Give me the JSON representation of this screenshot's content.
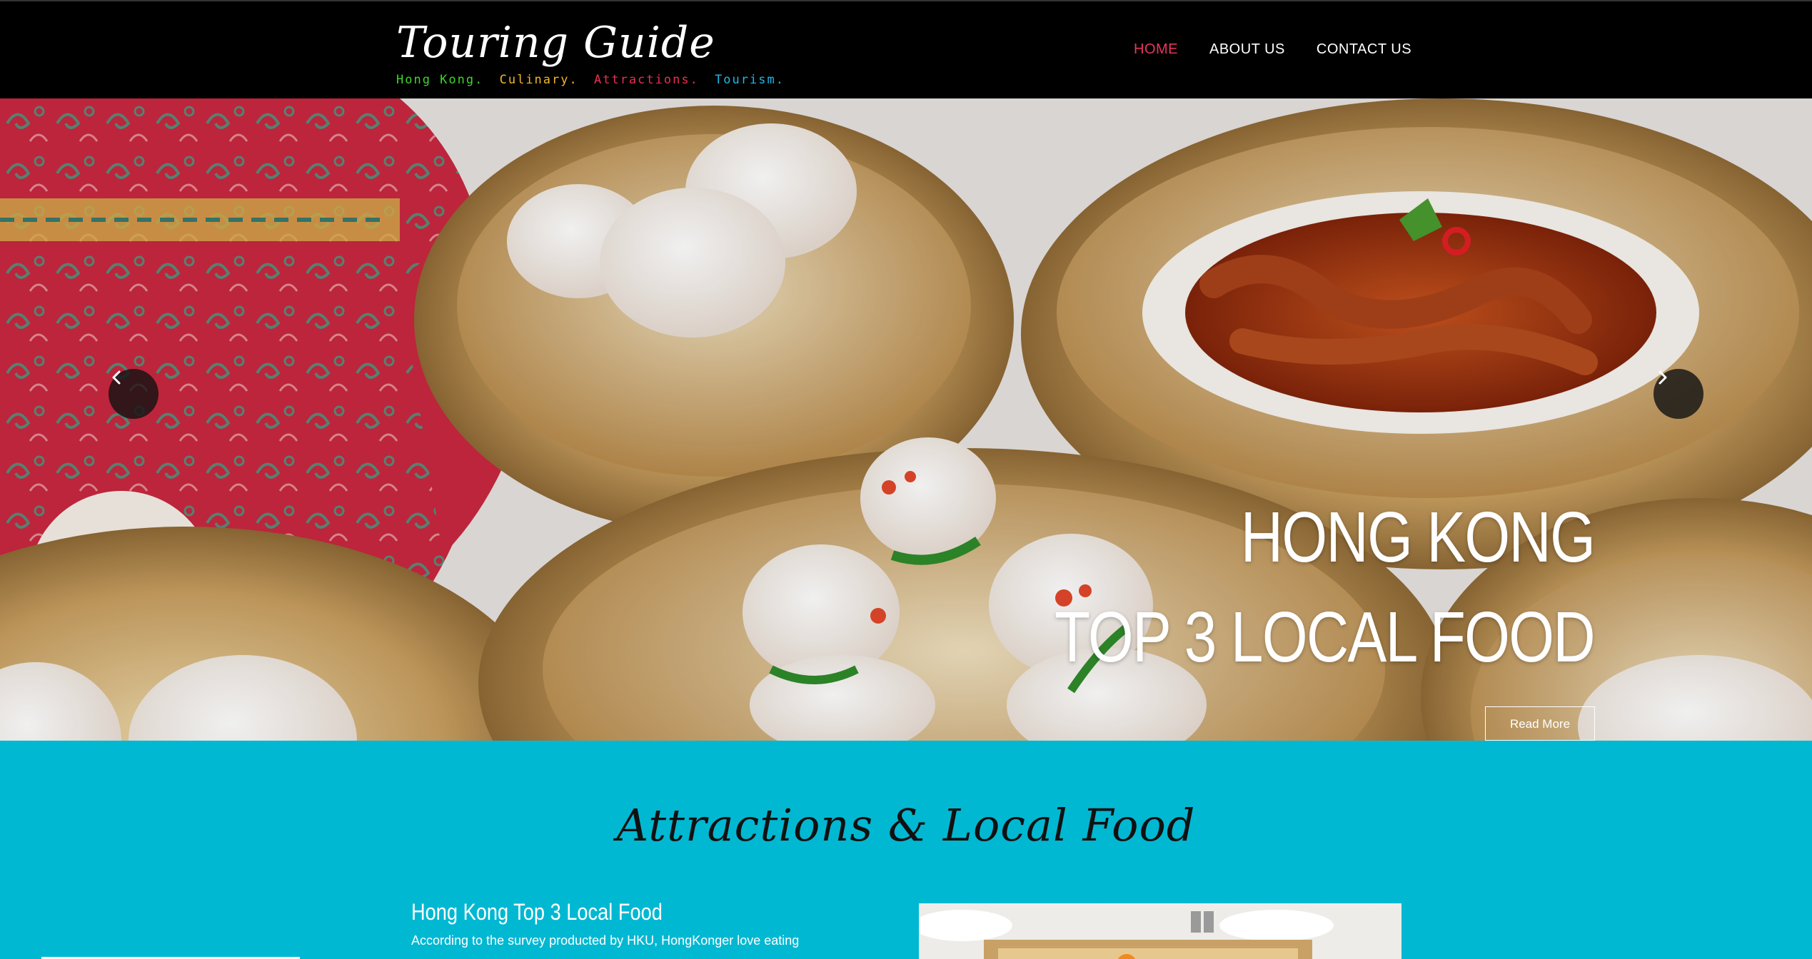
{
  "header": {
    "logo_title": "Touring Guide",
    "tagline": [
      {
        "text": "Hong Kong.",
        "color": "#3ed62b"
      },
      {
        "text": "Culinary.",
        "color": "#f1b52e"
      },
      {
        "text": "Attractions.",
        "color": "#e8304f"
      },
      {
        "text": "Tourism.",
        "color": "#20b8e6"
      }
    ],
    "nav": [
      {
        "label": "HOME",
        "active": true
      },
      {
        "label": "ABOUT US",
        "active": false
      },
      {
        "label": "CONTACT US",
        "active": false
      }
    ]
  },
  "hero": {
    "prev_icon": "chevron-left-icon",
    "next_icon": "chevron-right-icon",
    "caption_line1": "HONG KONG",
    "caption_line2": "TOP 3 LOCAL FOOD",
    "read_more": "Read More"
  },
  "section": {
    "title": "Attractions & Local Food",
    "post_title": "Hong Kong Top 3 Local Food",
    "post_excerpt": "According to the survey producted by HKU, HongKonger love eating",
    "background": "#01b8d2"
  },
  "colors": {
    "nav_active": "#e5365f",
    "header_bg": "#000000"
  }
}
